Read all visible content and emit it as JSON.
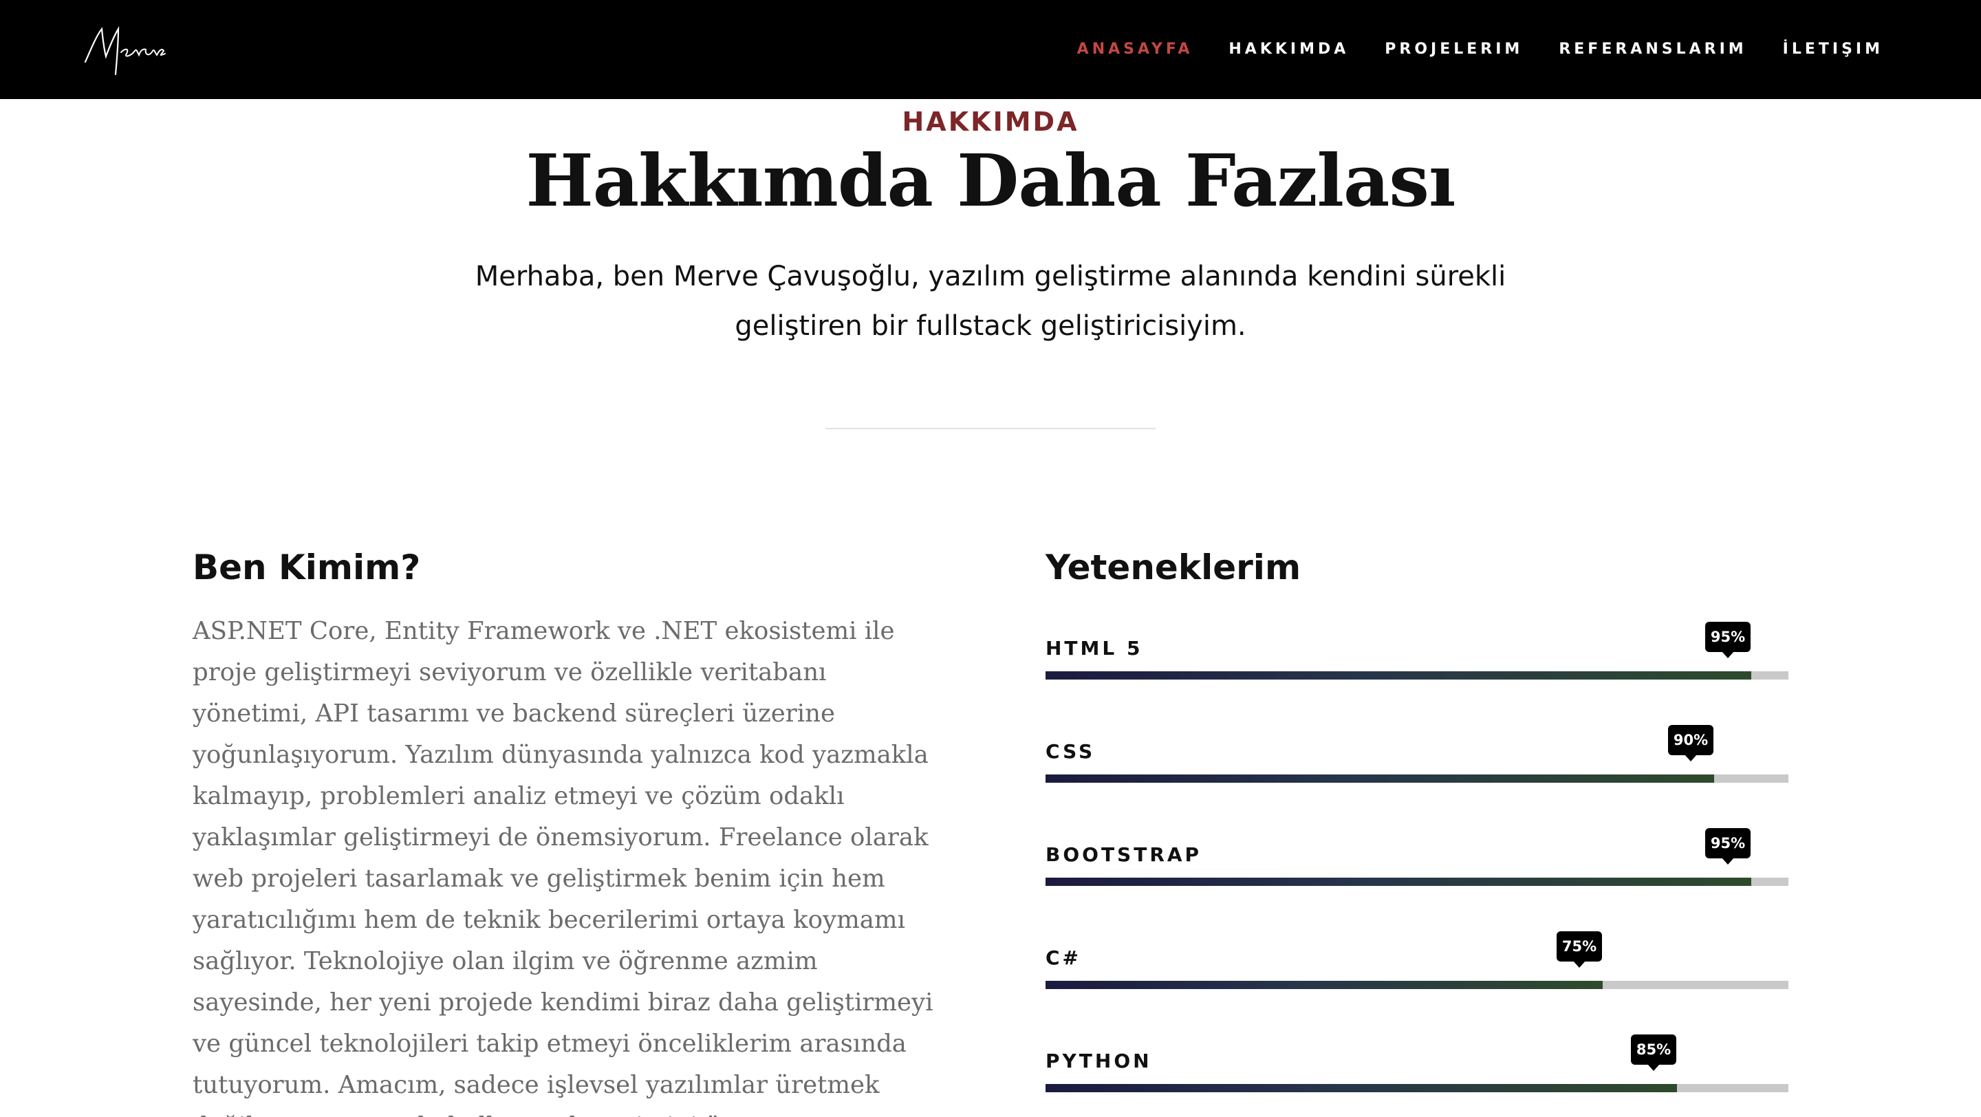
{
  "brand": {
    "logo_text": "Merve"
  },
  "nav": {
    "items": [
      {
        "label": "ANASAYFA",
        "active": true
      },
      {
        "label": "HAKKIMDA",
        "active": false
      },
      {
        "label": "PROJELERIM",
        "active": false
      },
      {
        "label": "REFERANSLARIM",
        "active": false
      },
      {
        "label": "İLETIŞIM",
        "active": false
      }
    ]
  },
  "section": {
    "eyebrow": "HAKKIMDA",
    "title": "Hakkımda Daha Fazlası",
    "intro": "Merhaba, ben Merve Çavuşoğlu, yazılım geliştirme alanında kendini sürekli geliştiren bir fullstack geliştiricisiyim."
  },
  "about": {
    "title": "Ben Kimim?",
    "text": "ASP.NET Core, Entity Framework ve .NET ekosistemi ile proje geliştirmeyi seviyorum ve özellikle veritabanı yönetimi, API tasarımı ve backend süreçleri üzerine yoğunlaşıyorum. Yazılım dünyasında yalnızca kod yazmakla kalmayıp, problemleri analiz etmeyi ve çözüm odaklı yaklaşımlar geliştirmeyi de önemsiyorum. Freelance olarak web projeleri tasarlamak ve geliştirmek benim için hem yaratıcılığımı hem de teknik becerilerimi ortaya koymamı sağlıyor. Teknolojiye olan ilgim ve öğrenme azmim sayesinde, her yeni projede kendimi biraz daha geliştirmeyi ve güncel teknolojileri takip etmeyi önceliklerim arasında tutuyorum. Amacım, sadece işlevsel yazılımlar üretmek değil, aynı zamanda kullanıcı deneyimini önemseyen,"
  },
  "skills": {
    "title": "Yeteneklerim",
    "items": [
      {
        "name": "HTML 5",
        "percent": 95,
        "label": "95%"
      },
      {
        "name": "CSS",
        "percent": 90,
        "label": "90%"
      },
      {
        "name": "BOOTSTRAP",
        "percent": 95,
        "label": "95%"
      },
      {
        "name": "C#",
        "percent": 75,
        "label": "75%"
      },
      {
        "name": "PYTHON",
        "percent": 85,
        "label": "85%"
      }
    ]
  },
  "colors": {
    "header_bg": "#000000",
    "nav_active": "#c44746",
    "eyebrow": "#7d2528",
    "bar_track": "#c9c9c9",
    "bar_fill_start": "#1b1a3f",
    "bar_fill_end": "#2e4a2c"
  }
}
